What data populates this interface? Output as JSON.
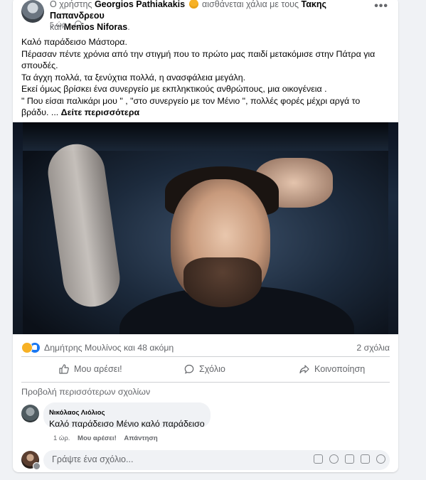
{
  "post": {
    "head_prefix": "Ο χρήστης",
    "author": "Georgios Pathiakakis",
    "feeling": "αισθάνεται χάλια με τους",
    "tag1": "Τακης Παπανδρεου",
    "conj": "και",
    "tag2": "Menios Niforas",
    "tag2_suffix": ".",
    "time": "5 ώρ. ·",
    "text_lines": [
      "Καλό παράδεισο Μάστορα.",
      "Πέρασαν πέντε χρόνια από την στιγμή που το πρώτο μας παιδί μετακόμισε στην Πάτρα για",
      "σπουδές.",
      "Τα άγχη πολλά, τα ξενύχτια πολλά, η ανασφάλεια μεγάλη.",
      "Εκεί όμως βρίσκει ένα συνεργείο με εκπληκτικούς ανθρώπους, μια οικογένεια .",
      "\" Που είσαι παλικάρι μου \" , \"στο συνεργείο με τον Μένιο  \",  πολλές φορές μέχρι αργά το"
    ],
    "last_line_prefix": "βράδυ. ... ",
    "see_more": "Δείτε περισσότερα"
  },
  "stats": {
    "reactors": "Δημήτρης Μουλίνος και 48 ακόμη",
    "comments": "2 σχόλια"
  },
  "actions": {
    "like": "Μου αρέσει!",
    "comment": "Σχόλιο",
    "share": "Κοινοποίηση"
  },
  "view_more_comments": "Προβολή περισσότερων σχολίων",
  "comment": {
    "author": "Νικόλαος Λιόλιος",
    "text": "Καλό παράδεισο Μένιο καλό παράδεισο",
    "time": "1 ώρ.",
    "like": "Μου αρέσει!",
    "reply": "Απάντηση"
  },
  "composer": {
    "placeholder": "Γράψτε ένα σχόλιο..."
  },
  "colors": {
    "like_blue": "#1877f2",
    "secondary_text": "#65676b"
  }
}
